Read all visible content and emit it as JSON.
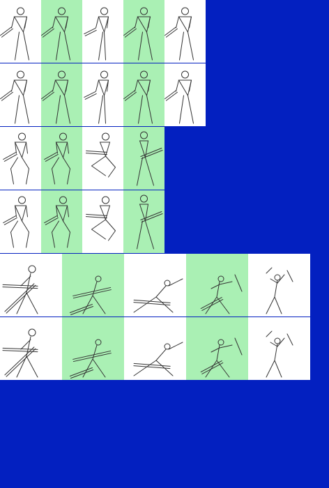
{
  "colors": {
    "background": "#0320c0",
    "cell_light": "#ffffff",
    "cell_alt": "#aaf0b4",
    "stroke": "#333333"
  },
  "rows": [
    {
      "count": 5,
      "poses": [
        "sword-rest",
        "sword-rest",
        "sword-step",
        "sword-rest",
        "sword-rest"
      ]
    },
    {
      "count": 5,
      "poses": [
        "sword-rest",
        "sword-rest",
        "sword-step",
        "sword-rest",
        "sword-rest"
      ]
    },
    {
      "count": 4,
      "poses": [
        "crouch-slash",
        "crouch-slash",
        "kneel-slash",
        "thrust"
      ]
    },
    {
      "count": 4,
      "poses": [
        "crouch-slash",
        "crouch-slash",
        "kneel-slash",
        "thrust"
      ]
    },
    {
      "count": 5,
      "poses": [
        "lunge-left",
        "lunge-right",
        "lunge-low",
        "arc-swing",
        "overhead"
      ]
    },
    {
      "count": 5,
      "poses": [
        "lunge-left",
        "lunge-right",
        "lunge-low",
        "arc-swing",
        "overhead"
      ]
    }
  ]
}
